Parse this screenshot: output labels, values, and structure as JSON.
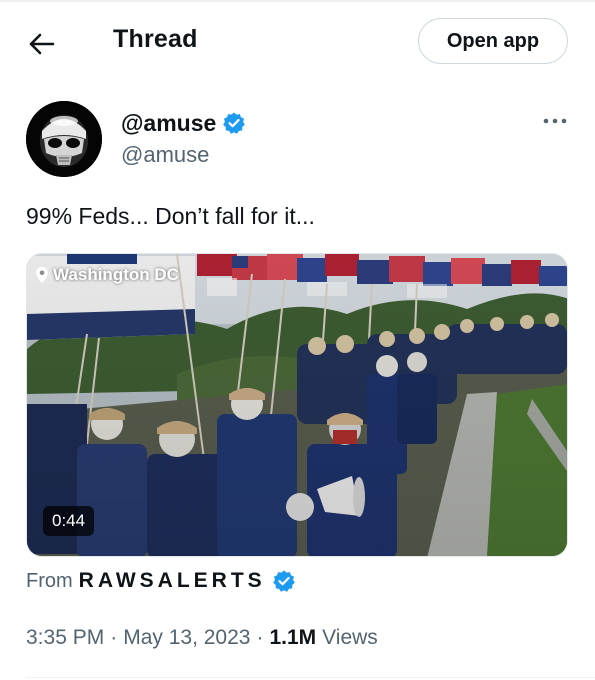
{
  "header": {
    "back_icon": "arrow-left-icon",
    "title": "Thread",
    "open_app_label": "Open app"
  },
  "author": {
    "avatar_icon": "stormtrooper-helmet-avatar",
    "display_name": "@amuse",
    "verified_icon": "verified-badge-icon",
    "handle": "@amuse",
    "more_icon": "more-horizontal-icon"
  },
  "tweet": {
    "text": "99% Feds... Don’t fall for it...",
    "media": {
      "type": "video",
      "location_icon": "location-pin-icon",
      "location": "Washington DC",
      "duration": "0:44"
    },
    "from_label": "From",
    "source_name": "RAWSALERTS",
    "source_verified_icon": "verified-badge-icon",
    "time": "3:35 PM",
    "separator": "·",
    "date": "May 13, 2023",
    "views_count": "1.1M",
    "views_label": "Views"
  },
  "colors": {
    "text_primary": "#0f1419",
    "text_secondary": "#536471",
    "verified_blue": "#1d9bf0",
    "border": "#cfd9de"
  }
}
